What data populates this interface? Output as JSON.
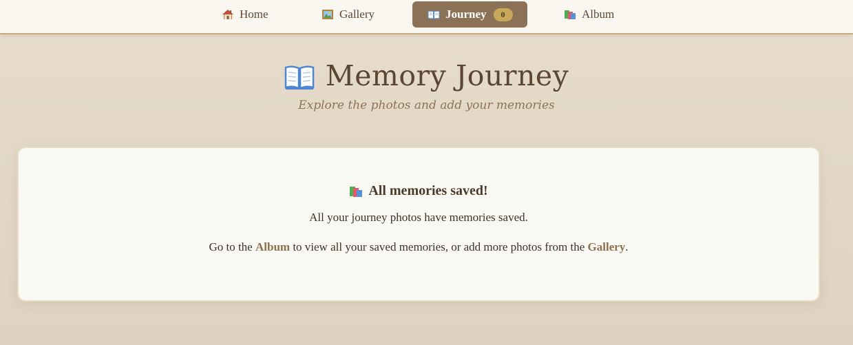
{
  "nav": {
    "items": [
      {
        "label": "Home",
        "icon": "house-icon"
      },
      {
        "label": "Gallery",
        "icon": "framed-picture-icon"
      },
      {
        "label": "Journey",
        "icon": "open-book-icon",
        "badge": "0",
        "active": true
      },
      {
        "label": "Album",
        "icon": "books-icon"
      }
    ]
  },
  "header": {
    "title": "Memory Journey",
    "subtitle": "Explore the photos and add your memories",
    "icon": "open-book-icon"
  },
  "card": {
    "title": "All memories saved!",
    "title_icon": "books-icon",
    "line1": "All your journey photos have memories saved.",
    "line2_prefix": "Go to the ",
    "album_link": "Album",
    "line2_middle": " to view all your saved memories, or add more photos from the ",
    "gallery_link": "Gallery",
    "line2_suffix": "."
  },
  "colors": {
    "accent": "#8b7155",
    "badge": "#c9a85c",
    "link": "#8b7150",
    "background": "#e5dac9",
    "card": "#faf8f2"
  }
}
